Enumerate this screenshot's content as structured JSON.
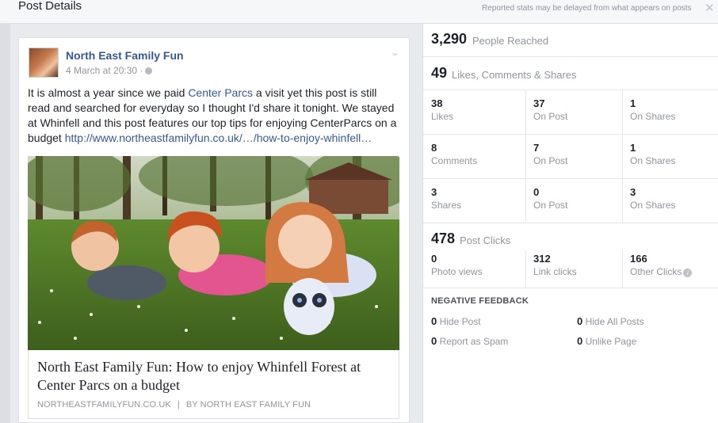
{
  "header": {
    "title": "Post Details",
    "notice": "Reported stats may be delayed from what appears on posts",
    "close_glyph": "✕"
  },
  "post": {
    "page_name": "North East Family Fun",
    "time": "4 March at 20:30 ·",
    "text_before": "It is almost a year since we paid ",
    "mention": "Center Parcs",
    "text_after": " a visit yet this post is still read and searched for everyday so I thought I'd share it tonight. We stayed at Whinfell and this post features our top tips for enjoying CenterParcs on a budget ",
    "link_text": "http://www.northeastfamilyfun.co.uk/…/how-to-enjoy-whinfell…",
    "link_preview": {
      "title": "North East Family Fun: How to enjoy Whinfell Forest at Center Parcs on a budget",
      "domain": "NORTHEASTFAMILYFUN.CO.UK",
      "separator": "|",
      "author": "BY NORTH EAST FAMILY FUN"
    }
  },
  "stats": {
    "reached": {
      "value": "3,290",
      "label": "People Reached"
    },
    "engagement": {
      "value": "49",
      "label": "Likes, Comments & Shares"
    },
    "grid": [
      [
        {
          "value": "38",
          "label": "Likes"
        },
        {
          "value": "37",
          "label": "On Post"
        },
        {
          "value": "1",
          "label": "On Shares"
        }
      ],
      [
        {
          "value": "8",
          "label": "Comments"
        },
        {
          "value": "7",
          "label": "On Post"
        },
        {
          "value": "1",
          "label": "On Shares"
        }
      ],
      [
        {
          "value": "3",
          "label": "Shares"
        },
        {
          "value": "0",
          "label": "On Post"
        },
        {
          "value": "3",
          "label": "On Shares"
        }
      ]
    ],
    "clicks": {
      "value": "478",
      "label": "Post Clicks"
    },
    "click_breakdown": [
      {
        "value": "0",
        "label": "Photo views"
      },
      {
        "value": "312",
        "label": "Link clicks"
      },
      {
        "value": "166",
        "label": "Other Clicks"
      }
    ],
    "info_glyph": "i",
    "negative": {
      "title": "NEGATIVE FEEDBACK",
      "items": [
        {
          "value": "0",
          "label": "Hide Post"
        },
        {
          "value": "0",
          "label": "Hide All Posts"
        },
        {
          "value": "0",
          "label": "Report as Spam"
        },
        {
          "value": "0",
          "label": "Unlike Page"
        }
      ]
    }
  },
  "colors": {
    "link_blue": "#365899",
    "muted_gray": "#90949c",
    "border": "#dddfe2",
    "background": "#e9eaed"
  },
  "icons": [
    "close-icon",
    "globe-icon",
    "chevron-down-icon",
    "info-icon"
  ]
}
